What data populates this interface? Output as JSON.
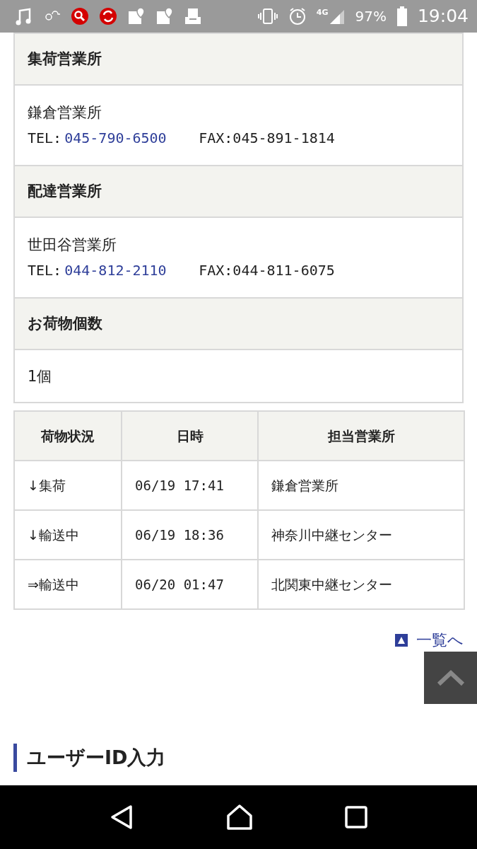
{
  "status_bar": {
    "network": "4G",
    "battery": "97%",
    "time": "19:04"
  },
  "info_sections": [
    {
      "kind": "office",
      "heading": "集荷営業所",
      "name": "鎌倉営業所",
      "tel_label": "TEL:",
      "tel": "045-790-6500",
      "fax": "FAX:045-891-1814"
    },
    {
      "kind": "office",
      "heading": "配達営業所",
      "name": "世田谷営業所",
      "tel_label": "TEL:",
      "tel": "044-812-2110",
      "fax": "FAX:044-811-6075"
    },
    {
      "kind": "count",
      "heading": "お荷物個数",
      "text": "1個"
    }
  ],
  "table": {
    "columns": [
      "荷物状況",
      "日時",
      "担当営業所"
    ],
    "rows": [
      [
        "↓集荷",
        "06/19 17:41",
        "鎌倉営業所"
      ],
      [
        "↓輸送中",
        "06/19 18:36",
        "神奈川中継センター"
      ],
      [
        "⇒輸送中",
        "06/20 01:47",
        "北関東中継センター"
      ]
    ]
  },
  "list_link": "一覧へ",
  "section_heading": "ユーザーID入力"
}
